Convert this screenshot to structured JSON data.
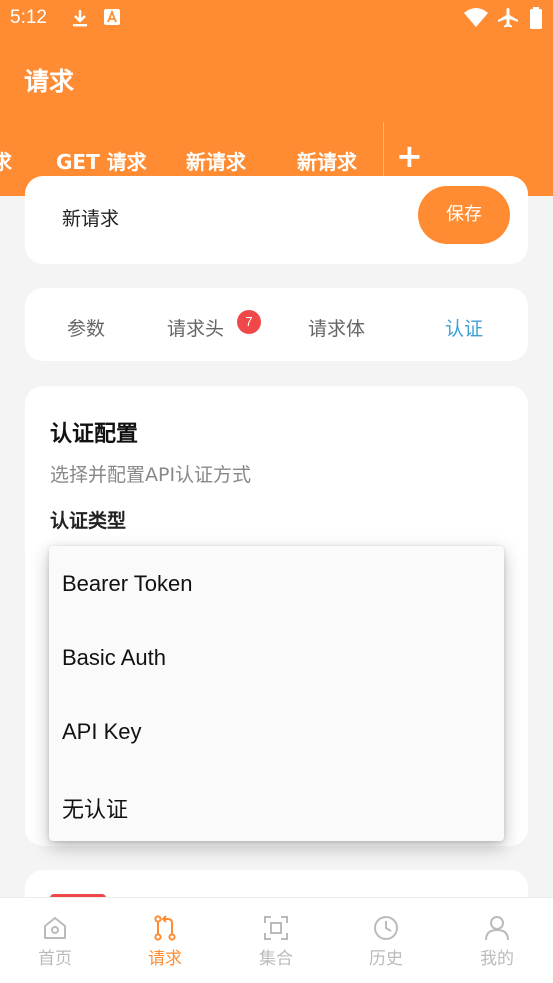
{
  "status_bar": {
    "time": "5:12",
    "icons": [
      "download-icon",
      "app-notification-icon",
      "wifi-icon",
      "airplane-icon",
      "battery-icon"
    ]
  },
  "app_bar": {
    "title": "请求"
  },
  "request_tabs": [
    {
      "label": "求",
      "partial": true
    },
    {
      "label": "GET 请求"
    },
    {
      "label": "新请求"
    },
    {
      "label": "新请求",
      "active": true
    }
  ],
  "add_tab_label": "+",
  "request": {
    "name": "新请求",
    "save_label": "保存"
  },
  "sub_tabs": [
    {
      "label": "参数"
    },
    {
      "label": "请求头",
      "badge": "7"
    },
    {
      "label": "请求体"
    },
    {
      "label": "认证",
      "active": true
    }
  ],
  "auth": {
    "title": "认证配置",
    "description": "选择并配置API认证方式",
    "type_label": "认证类型",
    "options": [
      "Bearer Token",
      "Basic Auth",
      "API Key",
      "无认证"
    ]
  },
  "bottom_nav": [
    {
      "label": "首页",
      "icon": "home-icon"
    },
    {
      "label": "请求",
      "icon": "pull-request-icon",
      "active": true
    },
    {
      "label": "集合",
      "icon": "collection-icon"
    },
    {
      "label": "历史",
      "icon": "history-clock-icon"
    },
    {
      "label": "我的",
      "icon": "profile-icon"
    }
  ],
  "colors": {
    "accent": "#ff8c33",
    "active_subtab": "#3e9fd6",
    "badge": "#f04848",
    "inactive_nav": "#bbbbbb"
  }
}
